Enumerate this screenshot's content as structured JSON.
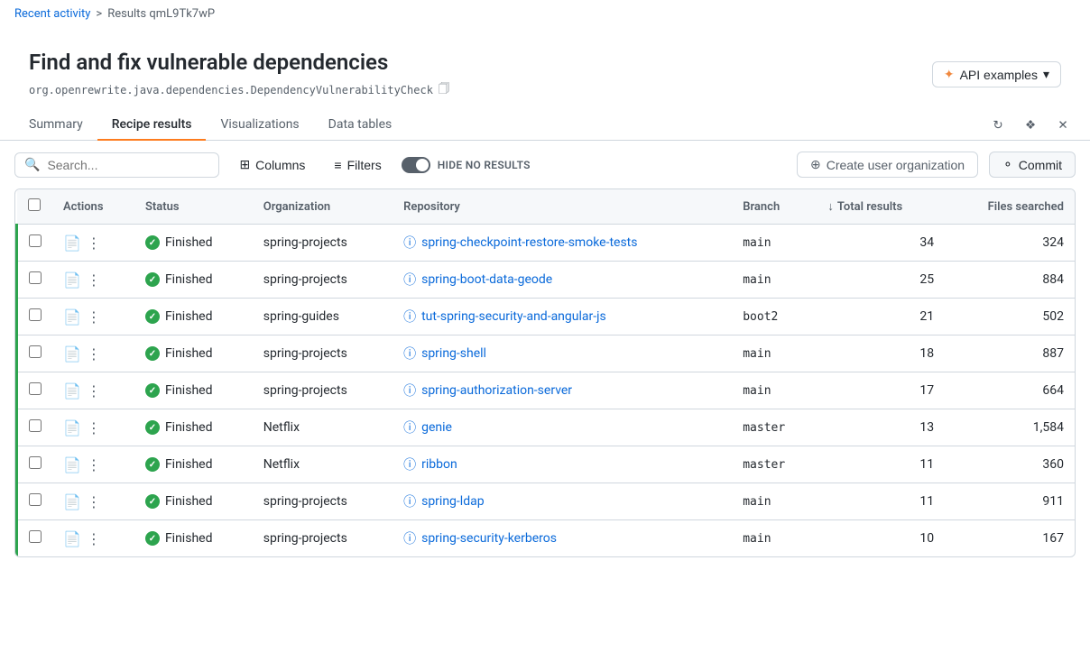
{
  "breadcrumb": {
    "recent": "Recent activity",
    "sep": ">",
    "current": "Results qmL9Tk7wP"
  },
  "page": {
    "title": "Find and fix vulnerable dependencies",
    "subtitle": "org.openrewrite.java.dependencies.DependencyVulnerabilityCheck",
    "api_btn": "API examples"
  },
  "tabs": [
    {
      "id": "summary",
      "label": "Summary"
    },
    {
      "id": "recipe-results",
      "label": "Recipe results",
      "active": true
    },
    {
      "id": "visualizations",
      "label": "Visualizations"
    },
    {
      "id": "data-tables",
      "label": "Data tables"
    }
  ],
  "toolbar": {
    "search_placeholder": "Search...",
    "columns_label": "Columns",
    "filters_label": "Filters",
    "hide_label": "HIDE NO RESULTS",
    "create_org_label": "Create user organization",
    "commit_label": "Commit"
  },
  "table": {
    "headers": [
      "",
      "Actions",
      "Status",
      "Organization",
      "Repository",
      "Branch",
      "Total results",
      "Files searched"
    ],
    "rows": [
      {
        "status": "Finished",
        "org": "spring-projects",
        "repo": "spring-checkpoint-restore-smoke-tests",
        "branch": "main",
        "total": "34",
        "files": "324"
      },
      {
        "status": "Finished",
        "org": "spring-projects",
        "repo": "spring-boot-data-geode",
        "branch": "main",
        "total": "25",
        "files": "884"
      },
      {
        "status": "Finished",
        "org": "spring-guides",
        "repo": "tut-spring-security-and-angular-js",
        "branch": "boot2",
        "total": "21",
        "files": "502"
      },
      {
        "status": "Finished",
        "org": "spring-projects",
        "repo": "spring-shell",
        "branch": "main",
        "total": "18",
        "files": "887"
      },
      {
        "status": "Finished",
        "org": "spring-projects",
        "repo": "spring-authorization-server",
        "branch": "main",
        "total": "17",
        "files": "664"
      },
      {
        "status": "Finished",
        "org": "Netflix",
        "repo": "genie",
        "branch": "master",
        "total": "13",
        "files": "1,584"
      },
      {
        "status": "Finished",
        "org": "Netflix",
        "repo": "ribbon",
        "branch": "master",
        "total": "11",
        "files": "360"
      },
      {
        "status": "Finished",
        "org": "spring-projects",
        "repo": "spring-ldap",
        "branch": "main",
        "total": "11",
        "files": "911"
      },
      {
        "status": "Finished",
        "org": "spring-projects",
        "repo": "spring-security-kerberos",
        "branch": "main",
        "total": "10",
        "files": "167"
      }
    ]
  }
}
